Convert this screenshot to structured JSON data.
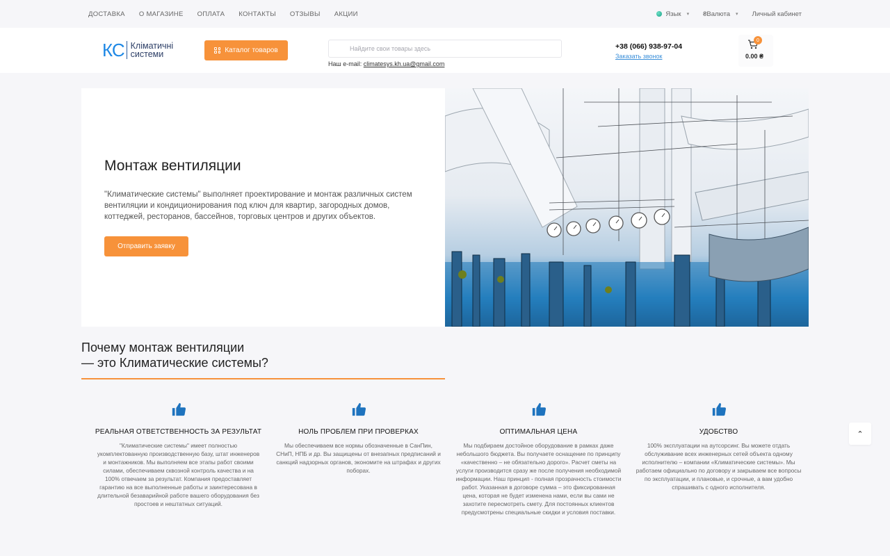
{
  "topnav": {
    "items": [
      "ДОСТАВКА",
      "О МАГАЗИНЕ",
      "ОПЛАТА",
      "КОНТАКТЫ",
      "ОТЗЫВЫ",
      "АКЦИИ"
    ],
    "language_label": "Язык",
    "currency_label": "₴Валюта",
    "account_label": "Личный кабинет"
  },
  "header": {
    "logo_mark": "КС",
    "logo_line1": "Кліматичні",
    "logo_line2": "системи",
    "catalog_button": "Каталог товаров",
    "search_placeholder": "Найдите свои товары здесь",
    "email_label": "Наш e-mail:",
    "email": "climatesys.kh.ua@gmail.com",
    "phone": "+38 (066) 938-97-04",
    "callback": "Заказать звонок",
    "cart_count": "0",
    "cart_total": "0.00 ₴"
  },
  "hero": {
    "title": "Монтаж вентиляции",
    "text": "\"Климатические системы\" выполняет проектирование и монтаж различных систем вентиляции и кондиционирования под ключ для квартир, загородных домов, коттеджей, ресторанов, бассейнов, торговых центров и других объектов.",
    "button": "Отправить заявку"
  },
  "why": {
    "title_line1": "Почему монтаж вентиляции",
    "title_line2": "— это Климатические системы?"
  },
  "features": [
    {
      "title": "РЕАЛЬНАЯ ОТВЕТСТВЕННОСТЬ ЗА РЕЗУЛЬТАТ",
      "text": "\"Климатические системы\" имеет полностью укомплектованную производственную базу, штат инженеров и монтажников. Мы выполняем все этапы работ своими силами, обеспечиваем сквозной контроль качества и на 100% отвечаем за результат. Компания предоставляет гарантию на все выполненные работы и заинтересована в длительной безаварийной работе вашего оборудования без простоев и нештатных ситуаций."
    },
    {
      "title": "НОЛЬ ПРОБЛЕМ ПРИ ПРОВЕРКАХ",
      "text": "Мы обеспечиваем все нормы обозначенные в СанПин, СНиП, НПБ и др. Вы защищены от внезапных предписаний и санкций надзорных органов, экономите на штрафах и других поборах."
    },
    {
      "title": "ОПТИМАЛЬНАЯ ЦЕНА",
      "text": "Мы подбираем достойное оборудование в рамках даже небольшого бюджета. Вы получаете оснащение по принципу «качественно – не обязательно дорого». Расчет сметы на услуги производится сразу же после получения необходимой информации. Наш принцип - полная прозрачность стоимости работ. Указанная в договоре сумма – это фиксированная цена, которая не будет изменена нами, если вы сами не захотите пересмотреть смету. Для постоянных клиентов предусмотрены специальные скидки и условия поставки."
    },
    {
      "title": "УДОБСТВО",
      "text": "100% эксплуатации на аутсорсинг. Вы можете отдать обслуживание всех инженерных сетей объекта одному исполнителю – компании «Климатические системы». Мы работаем официально по договору и закрываем все вопросы по эксплуатации, и плановые, и срочные, а вам удобно спрашивать с одного исполнителя."
    }
  ],
  "colors": {
    "accent": "#f7923a",
    "link": "#3b8fd9",
    "icon": "#1e73be"
  }
}
